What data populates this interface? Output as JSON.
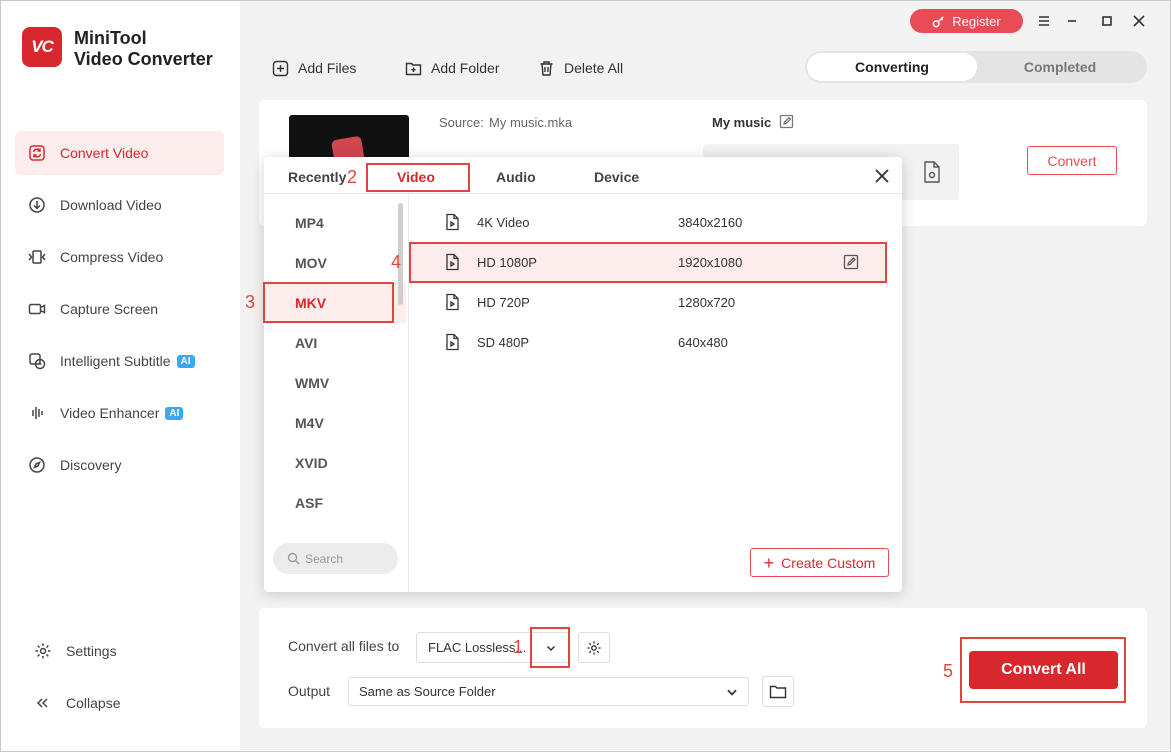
{
  "app": {
    "name_line1": "MiniTool",
    "name_line2": "Video Converter",
    "logo_text": "VC"
  },
  "sidebar": {
    "items": [
      {
        "label": "Convert Video",
        "icon": "convert-icon"
      },
      {
        "label": "Download Video",
        "icon": "download-icon"
      },
      {
        "label": "Compress Video",
        "icon": "compress-icon"
      },
      {
        "label": "Capture Screen",
        "icon": "camera-icon"
      },
      {
        "label": "Intelligent Subtitle",
        "icon": "subtitle-icon",
        "badge": "AI"
      },
      {
        "label": "Video Enhancer",
        "icon": "enhance-icon",
        "badge": "AI"
      },
      {
        "label": "Discovery",
        "icon": "compass-icon"
      }
    ],
    "settings_label": "Settings",
    "collapse_label": "Collapse"
  },
  "topbar": {
    "register_label": "Register"
  },
  "toolbar": {
    "add_files": "Add Files",
    "add_folder": "Add Folder",
    "delete_all": "Delete All"
  },
  "tabs_main": {
    "converting": "Converting",
    "completed": "Completed"
  },
  "file": {
    "source_label": "Source:",
    "source_value": "My music.mka",
    "title": "My music"
  },
  "convert_button": "Convert",
  "popup": {
    "tabs": [
      "Recently",
      "Video",
      "Audio",
      "Device"
    ],
    "active_tab": "Video",
    "formats": [
      "MP4",
      "MOV",
      "MKV",
      "AVI",
      "WMV",
      "M4V",
      "XVID",
      "ASF"
    ],
    "active_format": "MKV",
    "search_placeholder": "Search",
    "resolutions": [
      {
        "name": "4K Video",
        "size": "3840x2160"
      },
      {
        "name": "HD 1080P",
        "size": "1920x1080"
      },
      {
        "name": "HD 720P",
        "size": "1280x720"
      },
      {
        "name": "SD 480P",
        "size": "640x480"
      }
    ],
    "active_resolution": "HD 1080P",
    "create_custom": "Create Custom"
  },
  "bottom": {
    "convert_all_label": "Convert all files to",
    "convert_all_value": "FLAC Lossless...",
    "output_label": "Output",
    "output_value": "Same as Source Folder",
    "convert_all_button": "Convert All"
  },
  "annotations": [
    "1",
    "2",
    "3",
    "4",
    "5"
  ],
  "colors": {
    "accent": "#d9272e",
    "register": "#e84c55",
    "ai_badge": "#3aa8f5",
    "annotation": "#e0463f"
  }
}
